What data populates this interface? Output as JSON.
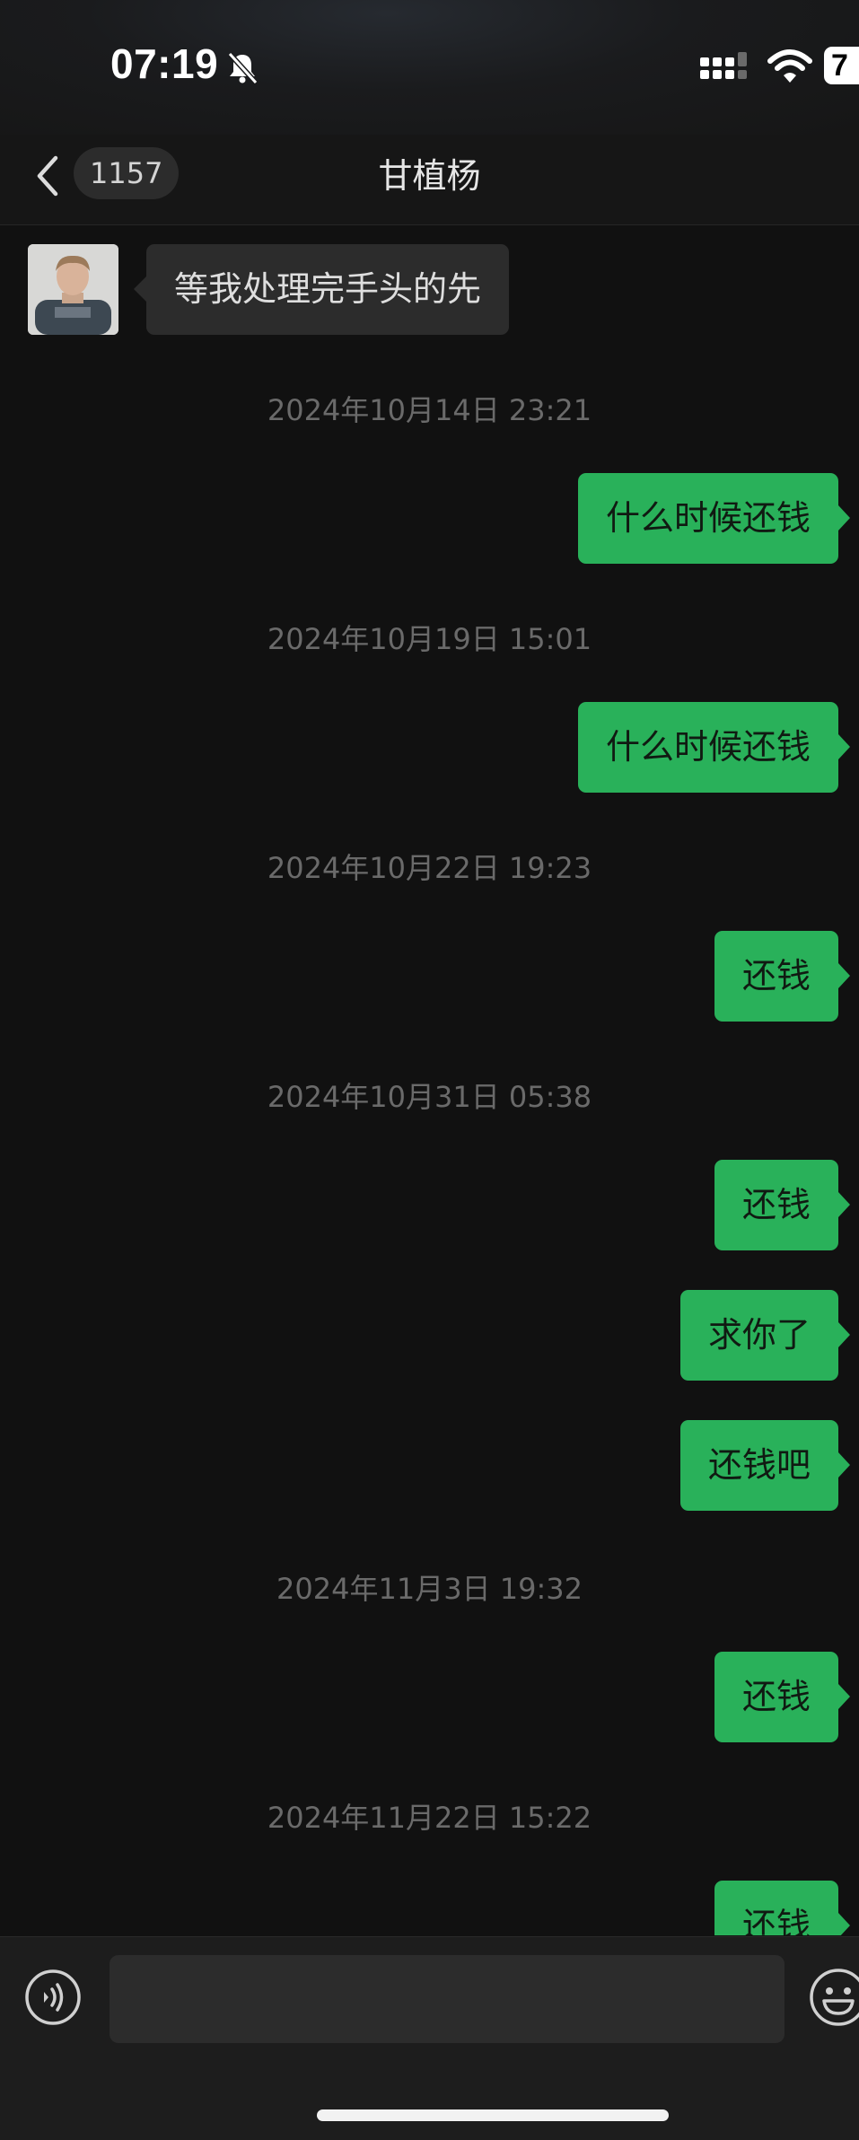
{
  "status_bar": {
    "time": "07:19",
    "battery": "7",
    "icons": [
      "bell-off-icon",
      "cellular-signal-icon",
      "wifi-icon",
      "battery-icon"
    ]
  },
  "nav": {
    "back_icon": "chevron-left-icon",
    "unread_count": "1157",
    "title": "甘植杨"
  },
  "messages": [
    {
      "kind": "incoming",
      "text": "等我处理完手头的先"
    },
    {
      "kind": "timestamp",
      "text": "2024年10月14日 23:21"
    },
    {
      "kind": "outgoing",
      "text": "什么时候还钱"
    },
    {
      "kind": "timestamp",
      "text": "2024年10月19日 15:01"
    },
    {
      "kind": "outgoing",
      "text": "什么时候还钱"
    },
    {
      "kind": "timestamp",
      "text": "2024年10月22日 19:23"
    },
    {
      "kind": "outgoing",
      "text": "还钱"
    },
    {
      "kind": "timestamp",
      "text": "2024年10月31日 05:38"
    },
    {
      "kind": "outgoing",
      "text": "还钱"
    },
    {
      "kind": "outgoing",
      "text": "求你了"
    },
    {
      "kind": "outgoing",
      "text": "还钱吧"
    },
    {
      "kind": "timestamp",
      "text": "2024年11月3日 19:32"
    },
    {
      "kind": "outgoing",
      "text": "还钱"
    },
    {
      "kind": "timestamp",
      "text": "2024年11月22日 15:22"
    },
    {
      "kind": "outgoing",
      "text": "还钱"
    }
  ],
  "input_bar": {
    "voice_icon": "voice-icon",
    "input_value": "",
    "emoji_icon": "emoji-icon"
  },
  "colors": {
    "background": "#111111",
    "outgoing_bubble": "#29b15a",
    "incoming_bubble": "#2c2c2c",
    "timestamp_text": "#6a6a6a"
  }
}
